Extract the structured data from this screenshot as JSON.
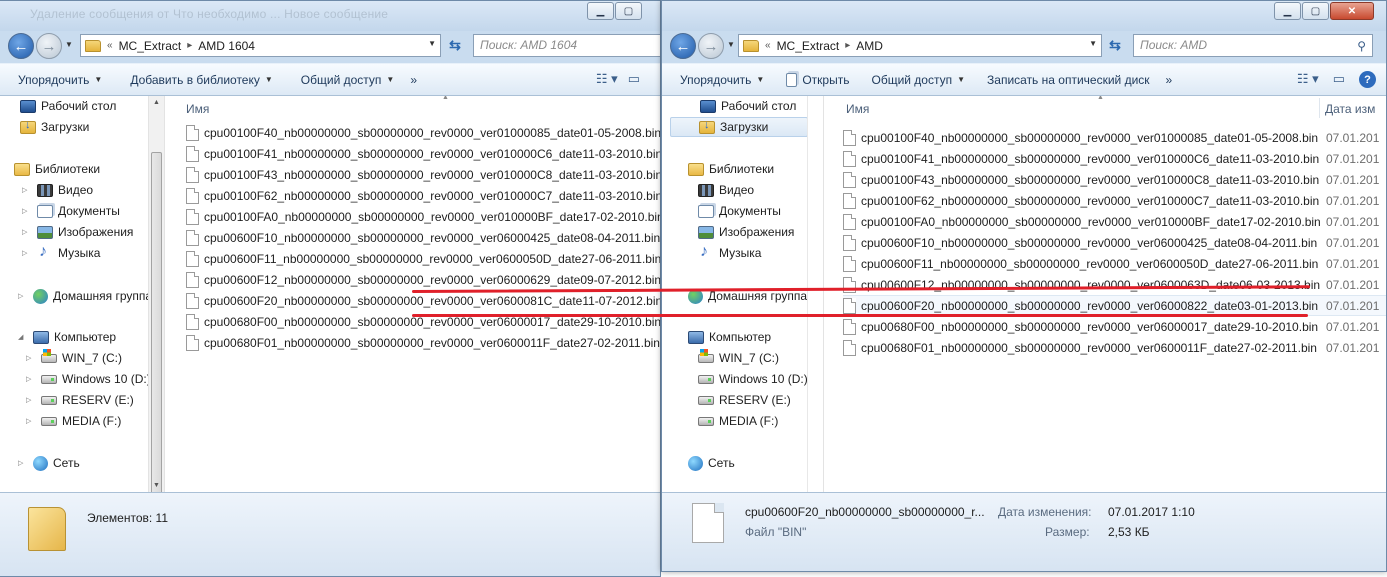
{
  "windows": {
    "left": {
      "title_ghost": "Удаление сообщения от    Что необходимо  ...  Новое сообщение",
      "breadcrumb": [
        "«",
        "MC_Extract",
        "AMD 1604"
      ],
      "search_placeholder": "Поиск: AMD 1604",
      "toolbar": [
        "Упорядочить",
        "Добавить в библиотеку",
        "Общий доступ",
        "»"
      ],
      "column_name": "Имя",
      "files": [
        "cpu00100F40_nb00000000_sb00000000_rev0000_ver01000085_date01-05-2008.bin",
        "cpu00100F41_nb00000000_sb00000000_rev0000_ver010000C6_date11-03-2010.bin",
        "cpu00100F43_nb00000000_sb00000000_rev0000_ver010000C8_date11-03-2010.bin",
        "cpu00100F62_nb00000000_sb00000000_rev0000_ver010000C7_date11-03-2010.bin",
        "cpu00100FA0_nb00000000_sb00000000_rev0000_ver010000BF_date17-02-2010.bin",
        "cpu00600F10_nb00000000_sb00000000_rev0000_ver06000425_date08-04-2011.bin",
        "cpu00600F11_nb00000000_sb00000000_rev0000_ver0600050D_date27-06-2011.bin",
        "cpu00600F12_nb00000000_sb00000000_rev0000_ver06000629_date09-07-2012.bin",
        "cpu00600F20_nb00000000_sb00000000_rev0000_ver0600081C_date11-07-2012.bin",
        "cpu00680F00_nb00000000_sb00000000_rev0000_ver06000017_date29-10-2010.bin",
        "cpu00680F01_nb00000000_sb00000000_rev0000_ver0600011F_date27-02-2011.bin"
      ],
      "status": "Элементов: 11"
    },
    "right": {
      "breadcrumb": [
        "«",
        "MC_Extract",
        "AMD"
      ],
      "search_placeholder": "Поиск: AMD",
      "toolbar": [
        "Упорядочить",
        "Открыть",
        "Общий доступ",
        "Записать на оптический диск",
        "»"
      ],
      "column_name": "Имя",
      "column_date": "Дата изм",
      "files": [
        {
          "name": "cpu00100F40_nb00000000_sb00000000_rev0000_ver01000085_date01-05-2008.bin",
          "date": "07.01.201"
        },
        {
          "name": "cpu00100F41_nb00000000_sb00000000_rev0000_ver010000C6_date11-03-2010.bin",
          "date": "07.01.201"
        },
        {
          "name": "cpu00100F43_nb00000000_sb00000000_rev0000_ver010000C8_date11-03-2010.bin",
          "date": "07.01.201"
        },
        {
          "name": "cpu00100F62_nb00000000_sb00000000_rev0000_ver010000C7_date11-03-2010.bin",
          "date": "07.01.201"
        },
        {
          "name": "cpu00100FA0_nb00000000_sb00000000_rev0000_ver010000BF_date17-02-2010.bin",
          "date": "07.01.201"
        },
        {
          "name": "cpu00600F10_nb00000000_sb00000000_rev0000_ver06000425_date08-04-2011.bin",
          "date": "07.01.201"
        },
        {
          "name": "cpu00600F11_nb00000000_sb00000000_rev0000_ver0600050D_date27-06-2011.bin",
          "date": "07.01.201"
        },
        {
          "name": "cpu00600F12_nb00000000_sb00000000_rev0000_ver0600063D_date06-03-2013.bin",
          "date": "07.01.201"
        },
        {
          "name": "cpu00600F20_nb00000000_sb00000000_rev0000_ver06000822_date03-01-2013.bin",
          "date": "07.01.201"
        },
        {
          "name": "cpu00680F00_nb00000000_sb00000000_rev0000_ver06000017_date29-10-2010.bin",
          "date": "07.01.201"
        },
        {
          "name": "cpu00680F01_nb00000000_sb00000000_rev0000_ver0600011F_date27-02-2011.bin",
          "date": "07.01.201"
        }
      ],
      "details": {
        "filename": "cpu00600F20_nb00000000_sb00000000_r...",
        "type": "Файл \"BIN\"",
        "modified_label": "Дата изменения:",
        "modified_value": "07.01.2017 1:10",
        "size_label": "Размер:",
        "size_value": "2,53 КБ"
      }
    }
  },
  "nav_tree": [
    {
      "label": "Рабочий стол",
      "icon": "desktop-icon"
    },
    {
      "label": "Загрузки",
      "icon": "downloads-icon"
    },
    {
      "label": "Библиотеки",
      "icon": "libraries-icon"
    },
    {
      "label": "Видео",
      "icon": "video-icon"
    },
    {
      "label": "Документы",
      "icon": "documents-icon"
    },
    {
      "label": "Изображения",
      "icon": "images-icon"
    },
    {
      "label": "Музыка",
      "icon": "music-icon"
    },
    {
      "label": "Домашняя группа",
      "icon": "homegroup-icon"
    },
    {
      "label": "Компьютер",
      "icon": "computer-icon"
    },
    {
      "label": "WIN_7 (C:)",
      "icon": "system-drive-icon"
    },
    {
      "label": "Windows 10 (D:)",
      "icon": "drive-icon"
    },
    {
      "label": "RESERV (E:)",
      "icon": "drive-icon"
    },
    {
      "label": "MEDIA (F:)",
      "icon": "drive-icon"
    },
    {
      "label": "Сеть",
      "icon": "network-icon"
    }
  ],
  "colors": {
    "annotation": "#e0202a",
    "frame": "#c9dcef"
  }
}
